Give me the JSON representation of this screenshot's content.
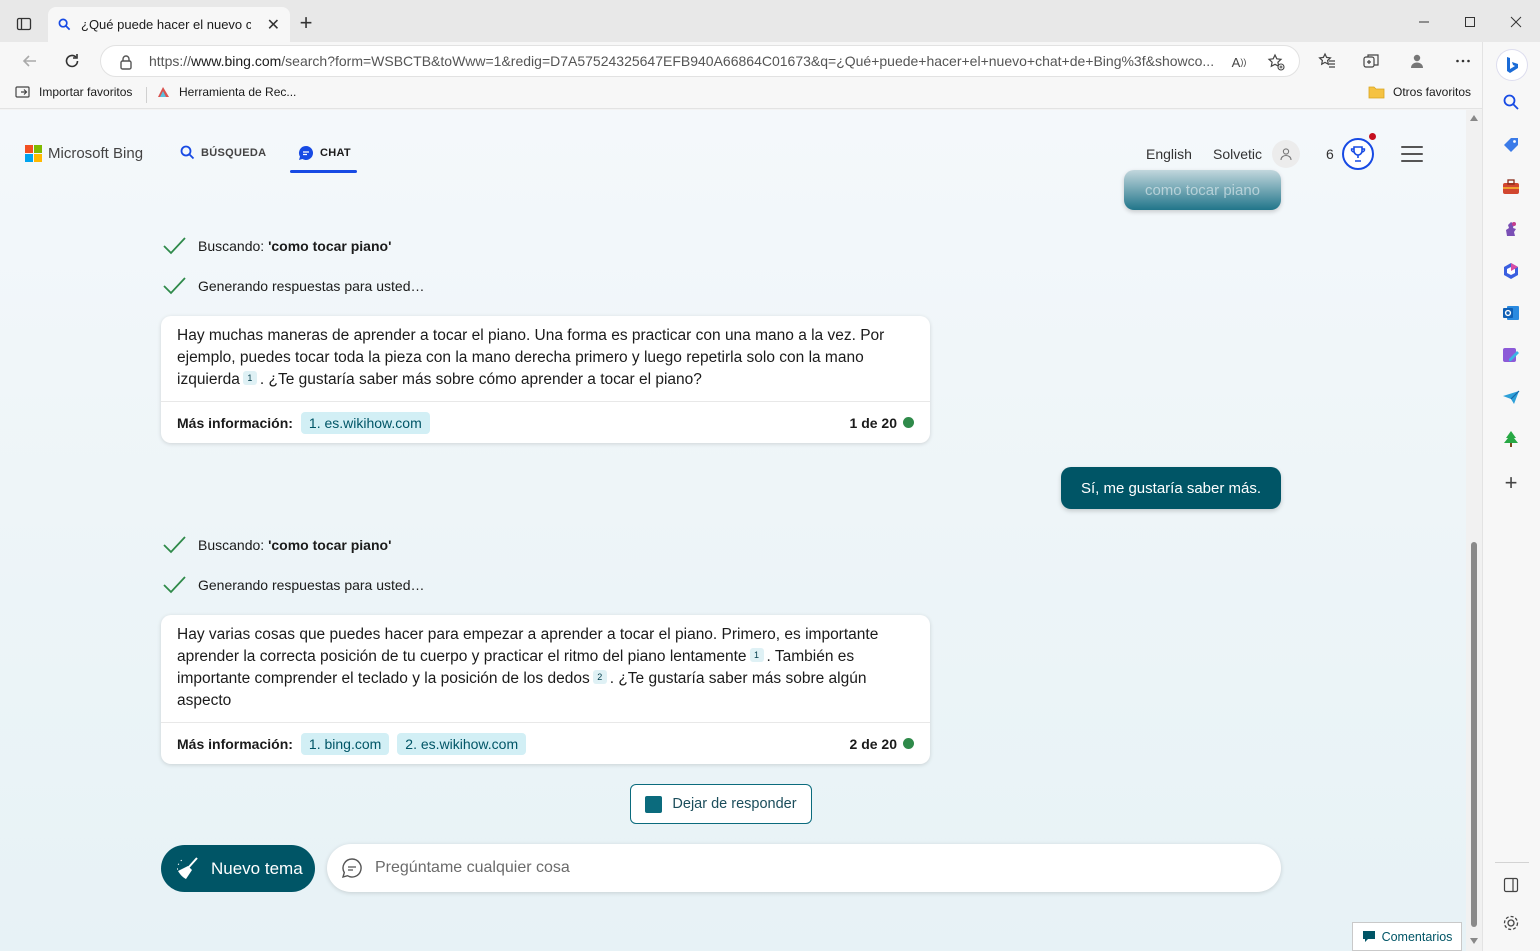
{
  "browser": {
    "tab_title": "¿Qué puede hacer el nuevo chat de Bing?",
    "url_prefix": "https://",
    "url_host": "www.bing.com",
    "url_rest": "/search?form=WSBCTB&toWww=1&redig=D7A57524325647EFB940A66864C01673&q=¿Qué+puede+hacer+el+nuevo+chat+de+Bing%3f&showco...",
    "favorites": [
      {
        "label": "Importar favoritos"
      },
      {
        "label": "Herramienta de Rec..."
      }
    ],
    "other_favorites": "Otros favoritos"
  },
  "header": {
    "logo_text": "Microsoft Bing",
    "nav_search": "BÚSQUEDA",
    "nav_chat": "CHAT",
    "language": "English",
    "user": "Solvetic",
    "points": "6"
  },
  "conversation": {
    "user_msg_1": "como tocar piano",
    "status_1a_prefix": "Buscando: ",
    "status_1a_query": "'como tocar piano'",
    "status_1b": "Generando respuestas para usted…",
    "answer_1": {
      "text_a": "Hay muchas maneras de aprender a tocar el piano. Una forma es practicar con una mano a la vez. Por ejemplo, puedes tocar toda la pieza con la mano derecha primero y luego repetirla solo con la mano izquierda",
      "cite_1": "1",
      "text_b": ". ¿Te gustaría saber más sobre cómo aprender a tocar el piano?",
      "more_label": "Más información:",
      "sources": [
        "1. es.wikihow.com"
      ],
      "count": "1 de 20"
    },
    "user_msg_2": "Sí, me gustaría saber más.",
    "status_2a_prefix": "Buscando: ",
    "status_2a_query": "'como tocar piano'",
    "status_2b": "Generando respuestas para usted…",
    "answer_2": {
      "text_a": "Hay varias cosas que puedes hacer para empezar a aprender a tocar el piano. Primero, es importante aprender la correcta posición de tu cuerpo y practicar el ritmo del piano lentamente",
      "cite_1": "1",
      "text_b": ". También es importante comprender el teclado y la posición de los dedos",
      "cite_2": "2",
      "text_c": ". ¿Te gustaría saber más sobre algún aspecto",
      "more_label": "Más información:",
      "sources": [
        "1. bing.com",
        "2. es.wikihow.com"
      ],
      "count": "2 de 20"
    }
  },
  "controls": {
    "stop_label": "Dejar de responder",
    "new_topic_label": "Nuevo tema",
    "ask_placeholder": "Pregúntame cualquier cosa",
    "feedback_label": "Comentarios"
  },
  "colors": {
    "accent": "#005566",
    "nav_blue": "#174ae4",
    "check_green": "#2f8a4a"
  }
}
